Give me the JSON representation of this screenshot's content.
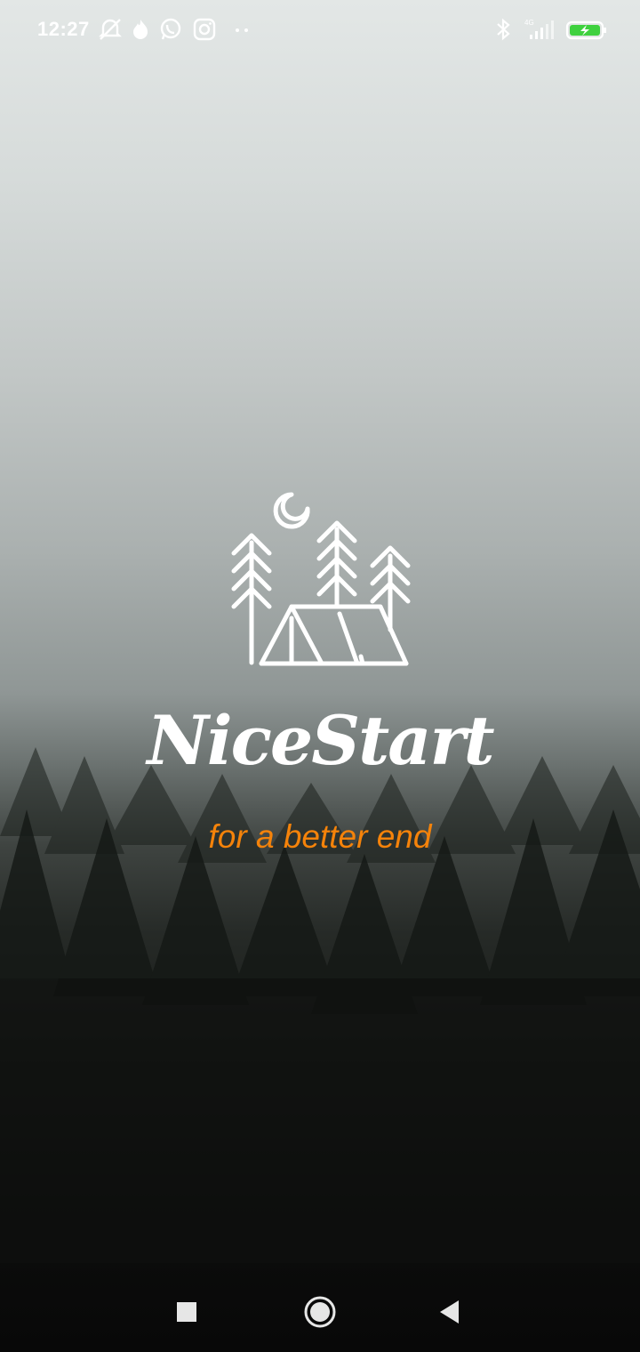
{
  "status_bar": {
    "time": "12:27",
    "left_icons": [
      "alarm-off-icon",
      "flame-icon",
      "whatsapp-icon",
      "instagram-icon",
      "more-notifications-icon"
    ],
    "right_icons": [
      "bluetooth-icon",
      "signal-4g-icon",
      "battery-charging-icon"
    ],
    "network_label": "4G",
    "battery_color": "#3fd13f"
  },
  "splash": {
    "brand_name": "NiceStart",
    "tagline": "for a better end",
    "tagline_color": "#f5830a",
    "logo_icon": "camping-tent-forest-moon-icon"
  },
  "nav_bar": {
    "buttons": [
      "recent-apps-button",
      "home-button",
      "back-button"
    ]
  }
}
